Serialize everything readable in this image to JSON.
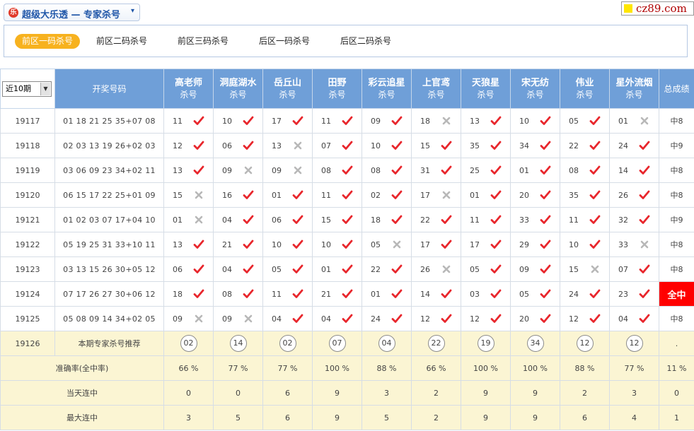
{
  "header": {
    "logo_glyph": "乐",
    "title": "超级大乐透 — 专家杀号",
    "caret": "▾",
    "watermark": "cz89.com"
  },
  "tabs": [
    {
      "label": "前区一码杀号",
      "active": true
    },
    {
      "label": "前区二码杀号",
      "active": false
    },
    {
      "label": "前区三码杀号",
      "active": false
    },
    {
      "label": "后区一码杀号",
      "active": false
    },
    {
      "label": "后区二码杀号",
      "active": false
    }
  ],
  "table": {
    "period_select": "近10期",
    "draw_header": "开奖号码",
    "kill_sub": "杀号",
    "total_header": "总成绩",
    "experts": [
      "高老师",
      "洞庭湖水",
      "岳丘山",
      "田野",
      "彩云追星",
      "上官鸢",
      "天狼星",
      "宋无纺",
      "伟业",
      "星外流烟"
    ],
    "rows": [
      {
        "issue": "19117",
        "draw": "01 18 21 25 35+07 08",
        "kills": [
          [
            "11",
            "ok"
          ],
          [
            "10",
            "ok"
          ],
          [
            "17",
            "ok"
          ],
          [
            "11",
            "ok"
          ],
          [
            "09",
            "ok"
          ],
          [
            "18",
            "x"
          ],
          [
            "13",
            "ok"
          ],
          [
            "10",
            "ok"
          ],
          [
            "05",
            "ok"
          ],
          [
            "01",
            "x"
          ]
        ],
        "total": "中8",
        "full": false
      },
      {
        "issue": "19118",
        "draw": "02 03 13 19 26+02 03",
        "kills": [
          [
            "12",
            "ok"
          ],
          [
            "06",
            "ok"
          ],
          [
            "13",
            "x"
          ],
          [
            "07",
            "ok"
          ],
          [
            "10",
            "ok"
          ],
          [
            "15",
            "ok"
          ],
          [
            "35",
            "ok"
          ],
          [
            "34",
            "ok"
          ],
          [
            "22",
            "ok"
          ],
          [
            "24",
            "ok"
          ]
        ],
        "total": "中9",
        "full": false
      },
      {
        "issue": "19119",
        "draw": "03 06 09 23 34+02 11",
        "kills": [
          [
            "13",
            "ok"
          ],
          [
            "09",
            "x"
          ],
          [
            "09",
            "x"
          ],
          [
            "08",
            "ok"
          ],
          [
            "08",
            "ok"
          ],
          [
            "31",
            "ok"
          ],
          [
            "25",
            "ok"
          ],
          [
            "01",
            "ok"
          ],
          [
            "08",
            "ok"
          ],
          [
            "14",
            "ok"
          ]
        ],
        "total": "中8",
        "full": false
      },
      {
        "issue": "19120",
        "draw": "06 15 17 22 25+01 09",
        "kills": [
          [
            "15",
            "x"
          ],
          [
            "16",
            "ok"
          ],
          [
            "01",
            "ok"
          ],
          [
            "11",
            "ok"
          ],
          [
            "02",
            "ok"
          ],
          [
            "17",
            "x"
          ],
          [
            "01",
            "ok"
          ],
          [
            "20",
            "ok"
          ],
          [
            "35",
            "ok"
          ],
          [
            "26",
            "ok"
          ]
        ],
        "total": "中8",
        "full": false
      },
      {
        "issue": "19121",
        "draw": "01 02 03 07 17+04 10",
        "kills": [
          [
            "01",
            "x"
          ],
          [
            "04",
            "ok"
          ],
          [
            "06",
            "ok"
          ],
          [
            "15",
            "ok"
          ],
          [
            "18",
            "ok"
          ],
          [
            "22",
            "ok"
          ],
          [
            "11",
            "ok"
          ],
          [
            "33",
            "ok"
          ],
          [
            "11",
            "ok"
          ],
          [
            "32",
            "ok"
          ]
        ],
        "total": "中9",
        "full": false
      },
      {
        "issue": "19122",
        "draw": "05 19 25 31 33+10 11",
        "kills": [
          [
            "13",
            "ok"
          ],
          [
            "21",
            "ok"
          ],
          [
            "10",
            "ok"
          ],
          [
            "10",
            "ok"
          ],
          [
            "05",
            "x"
          ],
          [
            "17",
            "ok"
          ],
          [
            "17",
            "ok"
          ],
          [
            "29",
            "ok"
          ],
          [
            "10",
            "ok"
          ],
          [
            "33",
            "x"
          ]
        ],
        "total": "中8",
        "full": false
      },
      {
        "issue": "19123",
        "draw": "03 13 15 26 30+05 12",
        "kills": [
          [
            "06",
            "ok"
          ],
          [
            "04",
            "ok"
          ],
          [
            "05",
            "ok"
          ],
          [
            "01",
            "ok"
          ],
          [
            "22",
            "ok"
          ],
          [
            "26",
            "x"
          ],
          [
            "05",
            "ok"
          ],
          [
            "09",
            "ok"
          ],
          [
            "15",
            "x"
          ],
          [
            "07",
            "ok"
          ]
        ],
        "total": "中8",
        "full": false
      },
      {
        "issue": "19124",
        "draw": "07 17 26 27 30+06 12",
        "kills": [
          [
            "18",
            "ok"
          ],
          [
            "08",
            "ok"
          ],
          [
            "11",
            "ok"
          ],
          [
            "21",
            "ok"
          ],
          [
            "01",
            "ok"
          ],
          [
            "14",
            "ok"
          ],
          [
            "03",
            "ok"
          ],
          [
            "05",
            "ok"
          ],
          [
            "24",
            "ok"
          ],
          [
            "23",
            "ok"
          ]
        ],
        "total": "全中",
        "full": true
      },
      {
        "issue": "19125",
        "draw": "05 08 09 14 34+02 05",
        "kills": [
          [
            "09",
            "x"
          ],
          [
            "09",
            "x"
          ],
          [
            "04",
            "ok"
          ],
          [
            "04",
            "ok"
          ],
          [
            "24",
            "ok"
          ],
          [
            "12",
            "ok"
          ],
          [
            "12",
            "ok"
          ],
          [
            "20",
            "ok"
          ],
          [
            "12",
            "ok"
          ],
          [
            "04",
            "ok"
          ]
        ],
        "total": "中8",
        "full": false
      }
    ],
    "recommend": {
      "issue": "19126",
      "label": "本期专家杀号推荐",
      "values": [
        "02",
        "14",
        "02",
        "07",
        "04",
        "22",
        "19",
        "34",
        "12",
        "12"
      ],
      "total": "."
    },
    "stats": [
      {
        "label": "准确率(全中率)",
        "values": [
          "66 %",
          "77 %",
          "77 %",
          "100 %",
          "88 %",
          "66 %",
          "100 %",
          "100 %",
          "88 %",
          "77 %"
        ],
        "total": "11 %"
      },
      {
        "label": "当天连中",
        "values": [
          "0",
          "0",
          "6",
          "9",
          "3",
          "2",
          "9",
          "9",
          "2",
          "3"
        ],
        "total": "0"
      },
      {
        "label": "最大连中",
        "values": [
          "3",
          "5",
          "6",
          "9",
          "5",
          "2",
          "9",
          "9",
          "6",
          "4"
        ],
        "total": "1"
      }
    ]
  },
  "colors": {
    "ok": "#e8262c",
    "x": "#b8b8b8",
    "header_bg": "#6f9fd8",
    "tab_active": "#f7b21f",
    "full_bg": "#ff0000"
  }
}
